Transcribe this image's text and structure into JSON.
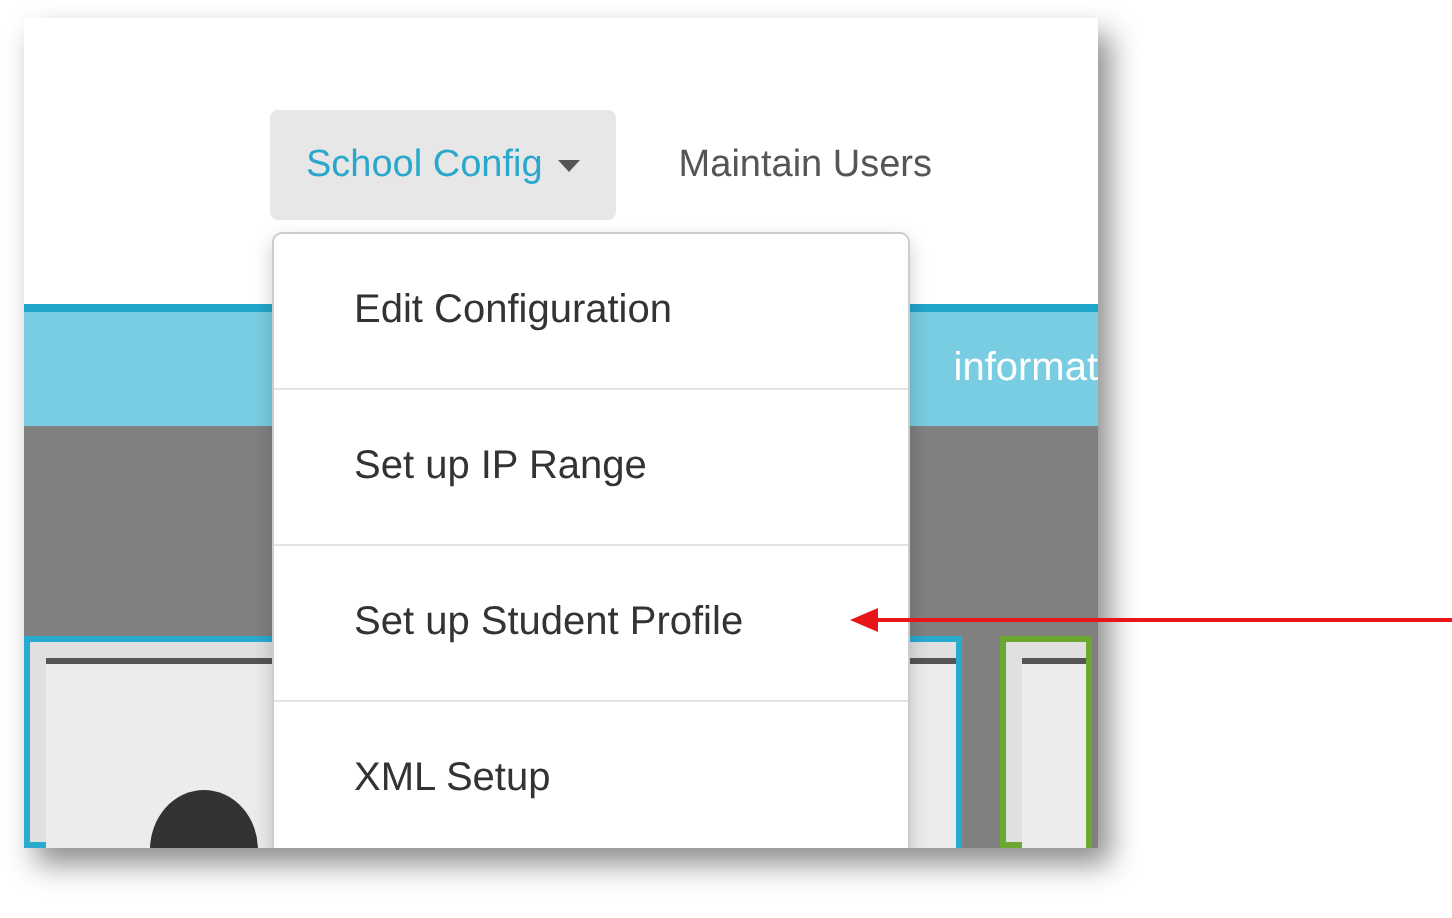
{
  "nav": [
    {
      "label": "School Config",
      "selected": true,
      "caret": true
    },
    {
      "label": "Maintain Users",
      "selected": false,
      "caret": false
    }
  ],
  "banner": {
    "text": "informat"
  },
  "menu": {
    "open": true,
    "items": [
      {
        "label": "Edit Configuration",
        "pointed": false
      },
      {
        "label": "Set up IP Range",
        "pointed": false
      },
      {
        "label": "Set up Student Profile",
        "pointed": true
      },
      {
        "label": "XML Setup",
        "pointed": false
      }
    ]
  },
  "cards": [
    {
      "color": "#29abd0",
      "kind": "avatar"
    },
    {
      "color": "#6aa832",
      "kind": "plain"
    }
  ]
}
